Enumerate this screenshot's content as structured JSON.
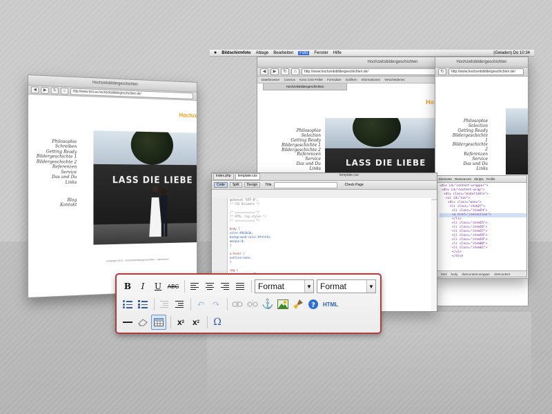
{
  "left_browser": {
    "title": "Hochzeitsbildergeschichten",
    "url": "http://www.test.ac.hochzeitsbildergeschichten.de/",
    "heading": "Hochze",
    "nav": [
      "Philosophie",
      "Schreiben",
      "Getting Ready",
      "Bildergeschichte 1",
      "Bildergeschichte 2",
      "Referenzen",
      "Service",
      "Das und Du",
      "Links"
    ],
    "nav_bottom": [
      "Blog",
      "Kontakt"
    ],
    "graffiti": "LASS DIE LIEBE RE",
    "footer": "Copyright 2013 · Hochzeitsbildergeschichten · Impressum"
  },
  "mac_menubar": {
    "app": "Bildschirmfoto",
    "items": [
      "Ablage",
      "Bearbeiten",
      "Foto",
      "Fenster",
      "Hilfe"
    ],
    "status": "(Geladen)  Do 10:34"
  },
  "center_browser": {
    "title": "Hochzeitsbildergeschichten",
    "url": "http://www.hochzeitsbildergeschichten.de/",
    "bookmarks": [
      "Dateibrowser",
      "Cosmos",
      "Kono CSS-Felter",
      "Formulare",
      "Grafiken",
      "Informationen",
      "Verschiedenes"
    ],
    "tab": "Hochzeitsbildergeschichten",
    "heading": "Ho",
    "nav": [
      "Philosophie",
      "Selection",
      "Getting Ready",
      "Bildergeschichte 1",
      "Bildergeschichte 2",
      "Referenzen",
      "Service",
      "Das und Du",
      "Links"
    ],
    "graffiti": "LASS DIE LIEBE"
  },
  "right_browser": {
    "title": "Hochzeitsbildergeschichten",
    "url": "http://www.hochzeitsbildergeschichten.de/",
    "nav": [
      "Philosophie",
      "Selection",
      "Getting Ready",
      "Bildergeschichte 1",
      "Bildergeschichte 2",
      "Referenzen",
      "Service",
      "Das und Du",
      "Links"
    ],
    "devtools_tabs": [
      "Elemente",
      "Ressourcen",
      "Skripts",
      "Profile"
    ],
    "devtools_lines": [
      "<div id=\"content-wrapper\">",
      "<div id=\"content-wrap\">",
      "<div class=\"modultable\">",
      "<ul id=\"nav\">",
      "<div class=\"menu\">",
      "<li class=\"item27\">",
      "<li class=\"item54\">",
      "<a href=\"/selection\">",
      "</li>",
      "<li class=\"item55\">",
      "<li class=\"item56\">",
      "<li class=\"item57\">",
      "<li class=\"item58\">",
      "<li class=\"item59\">",
      "<li class=\"item60\">",
      "<li class=\"item61\">",
      "</ul>",
      "</div>"
    ],
    "breadcrumb": [
      "html",
      "body",
      "div#content-wrapper",
      "div#content"
    ]
  },
  "code_editor": {
    "tabs": [
      "index.php",
      "template.css"
    ],
    "title": "template.css",
    "view_buttons": [
      "Code",
      "Split",
      "Design"
    ],
    "title_label": "Title",
    "check_label": "Check Page",
    "lines": [
      "@charset \"UTF-8\";",
      "/* CSS Document */",
      "",
      "/* ============ */",
      "/* HTML, tag styles */",
      "/* ============ */",
      "",
      "body {",
      "  color:#3b3b3b;",
      "  background-color:#fefefe;",
      "  margin:0;",
      "}",
      "",
      "a:hover {",
      "  outline:none;",
      "}",
      "",
      "img {",
      "  margin-bottom:15px;",
      "}",
      "",
      "/* ============ */",
      "/* Layout */",
      "/* ============ */",
      "",
      "#wrapper {",
      "  height:110px;",
      "  background-image:url(../../bg.png);",
      "}"
    ]
  },
  "rich_text_toolbar": {
    "bold": "B",
    "italic": "I",
    "underline": "U",
    "strike": "ABC",
    "format_1": "Format",
    "format_2": "Format",
    "html_label": "HTML",
    "subscript": "x",
    "superscript": "x",
    "omega": "Ω",
    "accent_color": "#b33b3b"
  }
}
